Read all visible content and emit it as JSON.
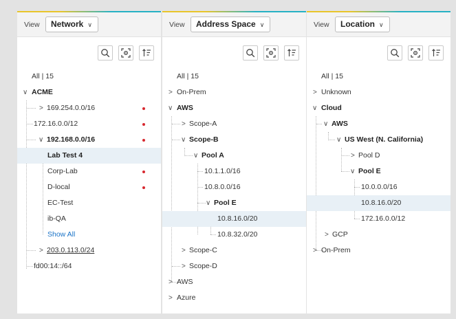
{
  "panels": [
    {
      "view_label": "View",
      "view_value": "Network",
      "tree": [
        {
          "label": "All | 15"
        },
        {
          "label": "ACME"
        },
        {
          "label": "169.254.0.0/16"
        },
        {
          "label": "172.16.0.0/12"
        },
        {
          "label": "192.168.0.0/16"
        },
        {
          "label": "Lab Test 4"
        },
        {
          "label": "Corp-Lab"
        },
        {
          "label": "D-local"
        },
        {
          "label": "EC-Test"
        },
        {
          "label": "ib-QA"
        },
        {
          "label": "Show All"
        },
        {
          "label": "203.0.113.0/24"
        },
        {
          "label": "fd00:14::/64"
        }
      ]
    },
    {
      "view_label": "View",
      "view_value": "Address Space",
      "tree": [
        {
          "label": "All | 15"
        },
        {
          "label": "On-Prem"
        },
        {
          "label": "AWS"
        },
        {
          "label": "Scope-A"
        },
        {
          "label": "Scope-B"
        },
        {
          "label": "Pool A"
        },
        {
          "label": "10.1.1.0/16"
        },
        {
          "label": "10.8.0.0/16"
        },
        {
          "label": "Pool E"
        },
        {
          "label": "10.8.16.0/20"
        },
        {
          "label": "10.8.32.0/20"
        },
        {
          "label": "Scope-C"
        },
        {
          "label": "Scope-D"
        },
        {
          "label": "AWS"
        },
        {
          "label": "Azure"
        }
      ]
    },
    {
      "view_label": "View",
      "view_value": "Location",
      "tree": [
        {
          "label": "All | 15"
        },
        {
          "label": "Unknown"
        },
        {
          "label": "Cloud"
        },
        {
          "label": "AWS"
        },
        {
          "label": "US West (N. California)"
        },
        {
          "label": "Pool D"
        },
        {
          "label": "Pool E"
        },
        {
          "label": "10.0.0.0/16"
        },
        {
          "label": "10.8.16.0/20"
        },
        {
          "label": "172.16.0.0/12"
        },
        {
          "label": "GCP"
        },
        {
          "label": "On-Prem"
        }
      ]
    }
  ],
  "icons": [
    "search-icon",
    "focus-icon",
    "sort-icon"
  ],
  "colors": {
    "alert_dot": "#d7282f",
    "selected_row": "#e8f0f6",
    "link": "#1a73c7",
    "accent_yellow": "#e9c52a",
    "accent_teal": "#26b1c4"
  }
}
